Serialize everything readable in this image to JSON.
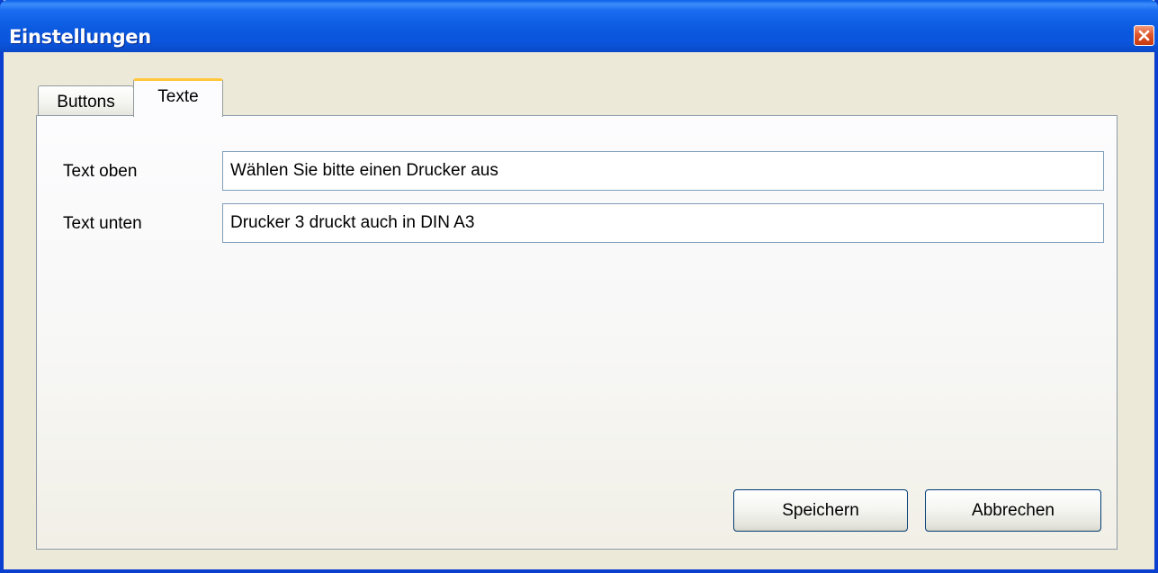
{
  "window": {
    "title": "Einstellungen"
  },
  "tabs": [
    {
      "label": "Buttons",
      "active": false
    },
    {
      "label": "Texte",
      "active": true
    }
  ],
  "fields": [
    {
      "label": "Text oben",
      "value": "Wählen Sie bitte einen Drucker aus"
    },
    {
      "label": "Text unten",
      "value": "Drucker 3 druckt auch in DIN A3"
    }
  ],
  "buttons": {
    "save_label": "Speichern",
    "cancel_label": "Abbrechen"
  },
  "icons": {
    "close": "close-icon"
  },
  "colors": {
    "titlebar": "#0a5fe6",
    "active_tab_accent": "#ffc83c",
    "close_button": "#e0562c",
    "dialog_background": "#ece9d8"
  }
}
